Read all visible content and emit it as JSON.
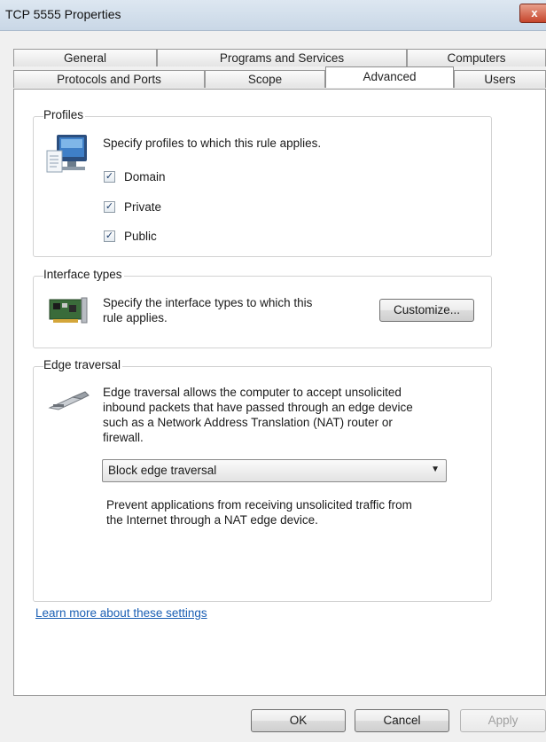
{
  "window": {
    "title": "TCP 5555 Properties",
    "close_glyph": "x"
  },
  "tabs": {
    "row1": [
      "General",
      "Programs and Services",
      "Computers"
    ],
    "row2": [
      "Protocols and Ports",
      "Scope",
      "Advanced",
      "Users"
    ],
    "active": "Advanced"
  },
  "profiles": {
    "title": "Profiles",
    "description": "Specify profiles to which this rule applies.",
    "icon": "monitor-icon",
    "checkboxes": [
      {
        "label": "Domain",
        "checked": true
      },
      {
        "label": "Private",
        "checked": true
      },
      {
        "label": "Public",
        "checked": true
      }
    ]
  },
  "interface_types": {
    "title": "Interface types",
    "icon": "network-card-icon",
    "description_line1": "Specify the interface types to which this",
    "description_line2": "rule applies.",
    "customize_label": "Customize..."
  },
  "edge_traversal": {
    "title": "Edge traversal",
    "icon": "network-cable-icon",
    "description_lines": [
      "Edge traversal allows the computer to accept unsolicited",
      "inbound packets that have passed through an edge device",
      "such as a Network Address Translation (NAT) router or",
      "firewall."
    ],
    "selected_option": "Block edge traversal",
    "help_lines": [
      "Prevent applications from receiving unsolicited traffic from",
      "the Internet through a NAT edge device."
    ]
  },
  "learn_more_link": "Learn more about these settings",
  "buttons": {
    "ok": "OK",
    "cancel": "Cancel",
    "apply": "Apply"
  }
}
